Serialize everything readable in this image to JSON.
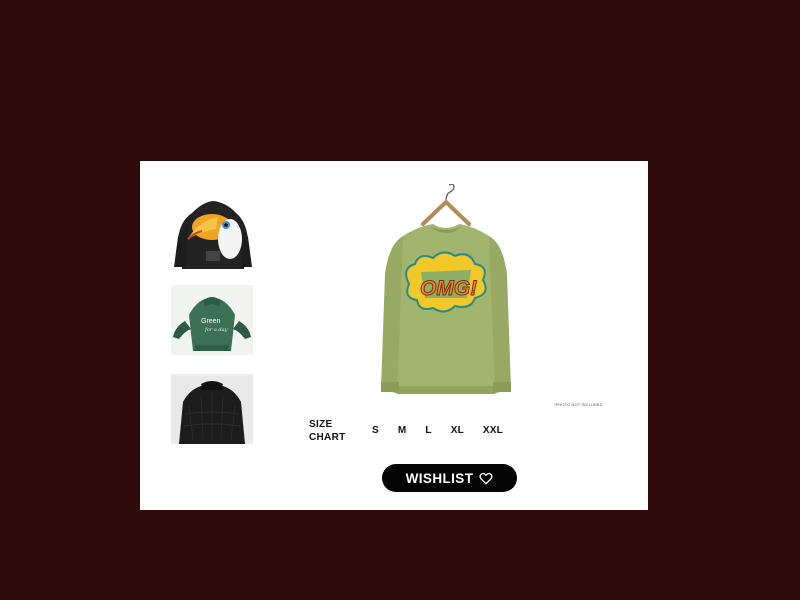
{
  "thumbnails": [
    {
      "name": "toucan-hoodie",
      "alt": "Black hoodie with toucan print"
    },
    {
      "name": "green-hoodie",
      "alt": "Green hoodie back print",
      "print_text": "Green"
    },
    {
      "name": "black-jacket",
      "alt": "Black quilted jacket"
    }
  ],
  "main_product": {
    "graphic_text": "OMG!",
    "photo_note": "*PHOTO NOT INCLUDED"
  },
  "size_chart": {
    "label": "SIZE CHART",
    "options": [
      "S",
      "M",
      "L",
      "XL",
      "XXL"
    ]
  },
  "wishlist": {
    "label": "WISHLIST",
    "icon": "heart-outline-icon"
  },
  "colors": {
    "background": "#300b0b",
    "card": "#ffffff",
    "button": "#050505",
    "sweatshirt": "#a3b46e",
    "graphic_yellow": "#f1c82a"
  }
}
